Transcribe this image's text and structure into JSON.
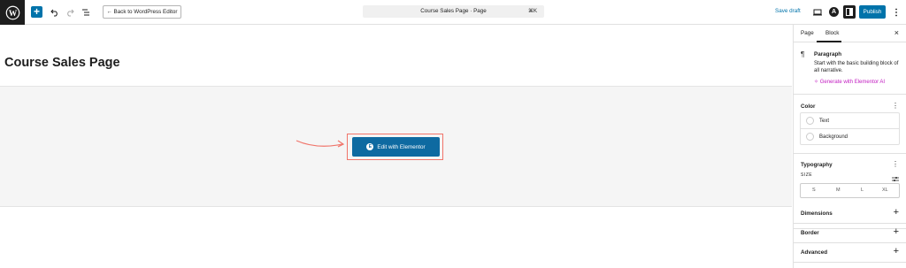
{
  "topbar": {
    "back_label": "← Back to WordPress Editor",
    "command_title": "Course Sales Page · Page",
    "command_shortcut": "⌘K",
    "save_draft": "Save draft",
    "publish": "Publish",
    "avatar_letter": "A"
  },
  "canvas": {
    "page_title": "Course Sales Page",
    "elementor_button": "Edit with Elementor",
    "elementor_badge": "E"
  },
  "sidebar": {
    "tabs": [
      "Page",
      "Block"
    ],
    "active_tab": "Block",
    "block": {
      "title": "Paragraph",
      "description": "Start with the basic building block of all narrative.",
      "ai_link": "Generate with Elementor AI"
    },
    "color": {
      "title": "Color",
      "items": [
        "Text",
        "Background"
      ]
    },
    "typography": {
      "title": "Typography",
      "size_label": "SIZE",
      "sizes": [
        "S",
        "M",
        "L",
        "XL"
      ]
    },
    "panels": [
      "Dimensions",
      "Border",
      "Advanced"
    ]
  },
  "colors": {
    "accent": "#0073aa",
    "elementor_button": "#0e6aa1",
    "highlight": "#f0746a",
    "ai_link": "#c21cc1"
  },
  "icons": [
    "wordpress-logo-icon",
    "add-block-icon",
    "undo-icon",
    "redo-icon",
    "document-overview-icon",
    "view-icon",
    "avatar-icon",
    "settings-sidebar-icon",
    "options-icon",
    "close-icon",
    "paragraph-icon",
    "sparkle-icon",
    "kebab-icon",
    "size-settings-icon",
    "plus-icon",
    "arrow-icon"
  ]
}
